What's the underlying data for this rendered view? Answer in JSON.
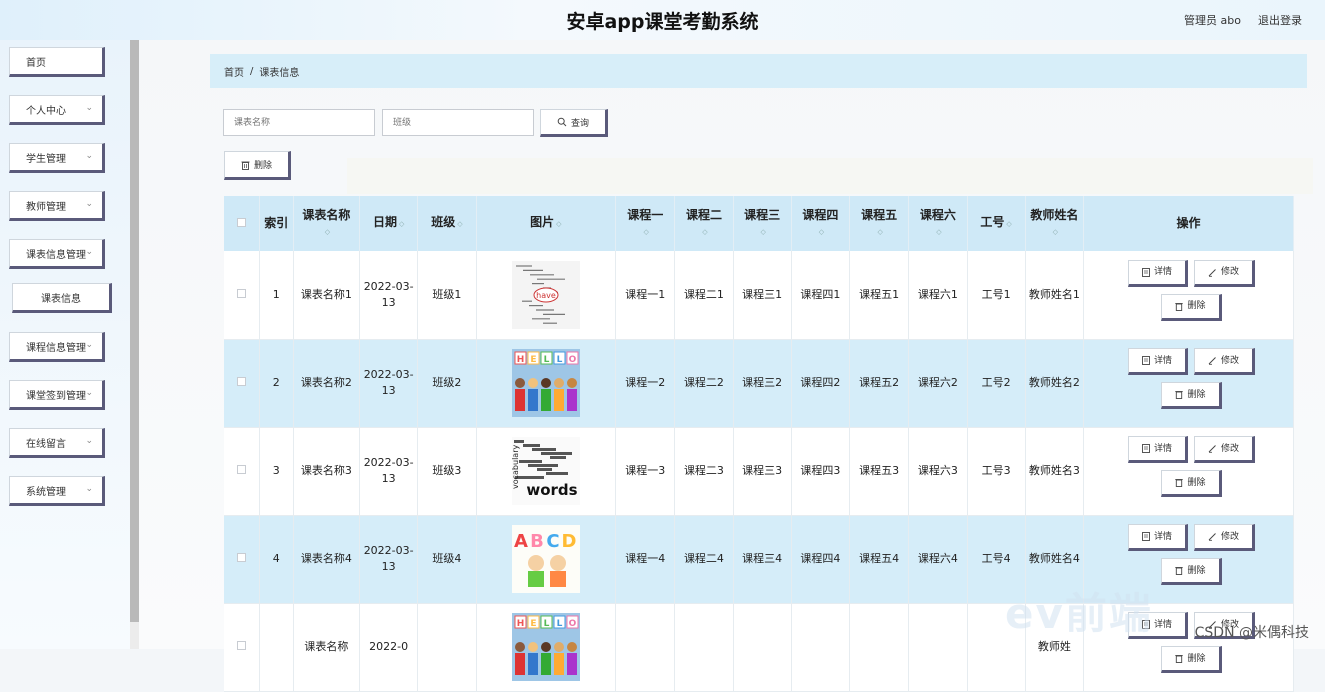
{
  "header": {
    "title": "安卓app课堂考勤系统",
    "admin": "管理员 abo",
    "logout": "退出登录"
  },
  "sidebar": {
    "items": [
      {
        "label": "首页",
        "chevron": false
      },
      {
        "label": "个人中心",
        "chevron": true
      },
      {
        "label": "学生管理",
        "chevron": true
      },
      {
        "label": "教师管理",
        "chevron": true
      },
      {
        "label": "课表信息管理",
        "chevron": true
      },
      {
        "label": "课表信息",
        "chevron": false,
        "sub": true
      },
      {
        "label": "课程信息管理",
        "chevron": true
      },
      {
        "label": "课堂签到管理",
        "chevron": true
      },
      {
        "label": "在线留言",
        "chevron": true
      },
      {
        "label": "系统管理",
        "chevron": true
      }
    ]
  },
  "breadcrumb": {
    "home": "首页",
    "sep": "/",
    "current": "课表信息"
  },
  "search": {
    "name_placeholder": "课表名称",
    "class_placeholder": "班级",
    "query_label": "查询",
    "delete_label": "删除"
  },
  "table": {
    "headers": [
      "索引",
      "课表名称",
      "日期",
      "班级",
      "图片",
      "课程一",
      "课程二",
      "课程三",
      "课程四",
      "课程五",
      "课程六",
      "工号",
      "教师姓名",
      "操作"
    ],
    "rows": [
      {
        "index": "1",
        "name": "课表名称1",
        "date": "2022-03-13",
        "class": "班级1",
        "image": "have-word-cloud",
        "c1": "课程一1",
        "c2": "课程二1",
        "c3": "课程三1",
        "c4": "课程四1",
        "c5": "课程五1",
        "c6": "课程六1",
        "id": "工号1",
        "teacher": "教师姓名1"
      },
      {
        "index": "2",
        "name": "课表名称2",
        "date": "2022-03-13",
        "class": "班级2",
        "image": "hello-kids",
        "c1": "课程一2",
        "c2": "课程二2",
        "c3": "课程三2",
        "c4": "课程四2",
        "c5": "课程五2",
        "c6": "课程六2",
        "id": "工号2",
        "teacher": "教师姓名2"
      },
      {
        "index": "3",
        "name": "课表名称3",
        "date": "2022-03-13",
        "class": "班级3",
        "image": "vocabulary-words",
        "c1": "课程一3",
        "c2": "课程二3",
        "c3": "课程三3",
        "c4": "课程四3",
        "c5": "课程五3",
        "c6": "课程六3",
        "id": "工号3",
        "teacher": "教师姓名3"
      },
      {
        "index": "4",
        "name": "课表名称4",
        "date": "2022-03-13",
        "class": "班级4",
        "image": "abcd-kids",
        "c1": "课程一4",
        "c2": "课程二4",
        "c3": "课程三4",
        "c4": "课程四4",
        "c5": "课程五4",
        "c6": "课程六4",
        "id": "工号4",
        "teacher": "教师姓名4"
      },
      {
        "index": "",
        "name": "课表名称",
        "date": "2022-0",
        "class": "",
        "image": "hello-kids",
        "c1": "",
        "c2": "",
        "c3": "",
        "c4": "",
        "c5": "",
        "c6": "",
        "id": "",
        "teacher": "教师姓"
      }
    ],
    "actions": {
      "detail": "详情",
      "edit": "修改",
      "delete": "删除"
    }
  },
  "watermark": {
    "logo": "ev前端",
    "csdn": "CSDN @米偶科技"
  }
}
